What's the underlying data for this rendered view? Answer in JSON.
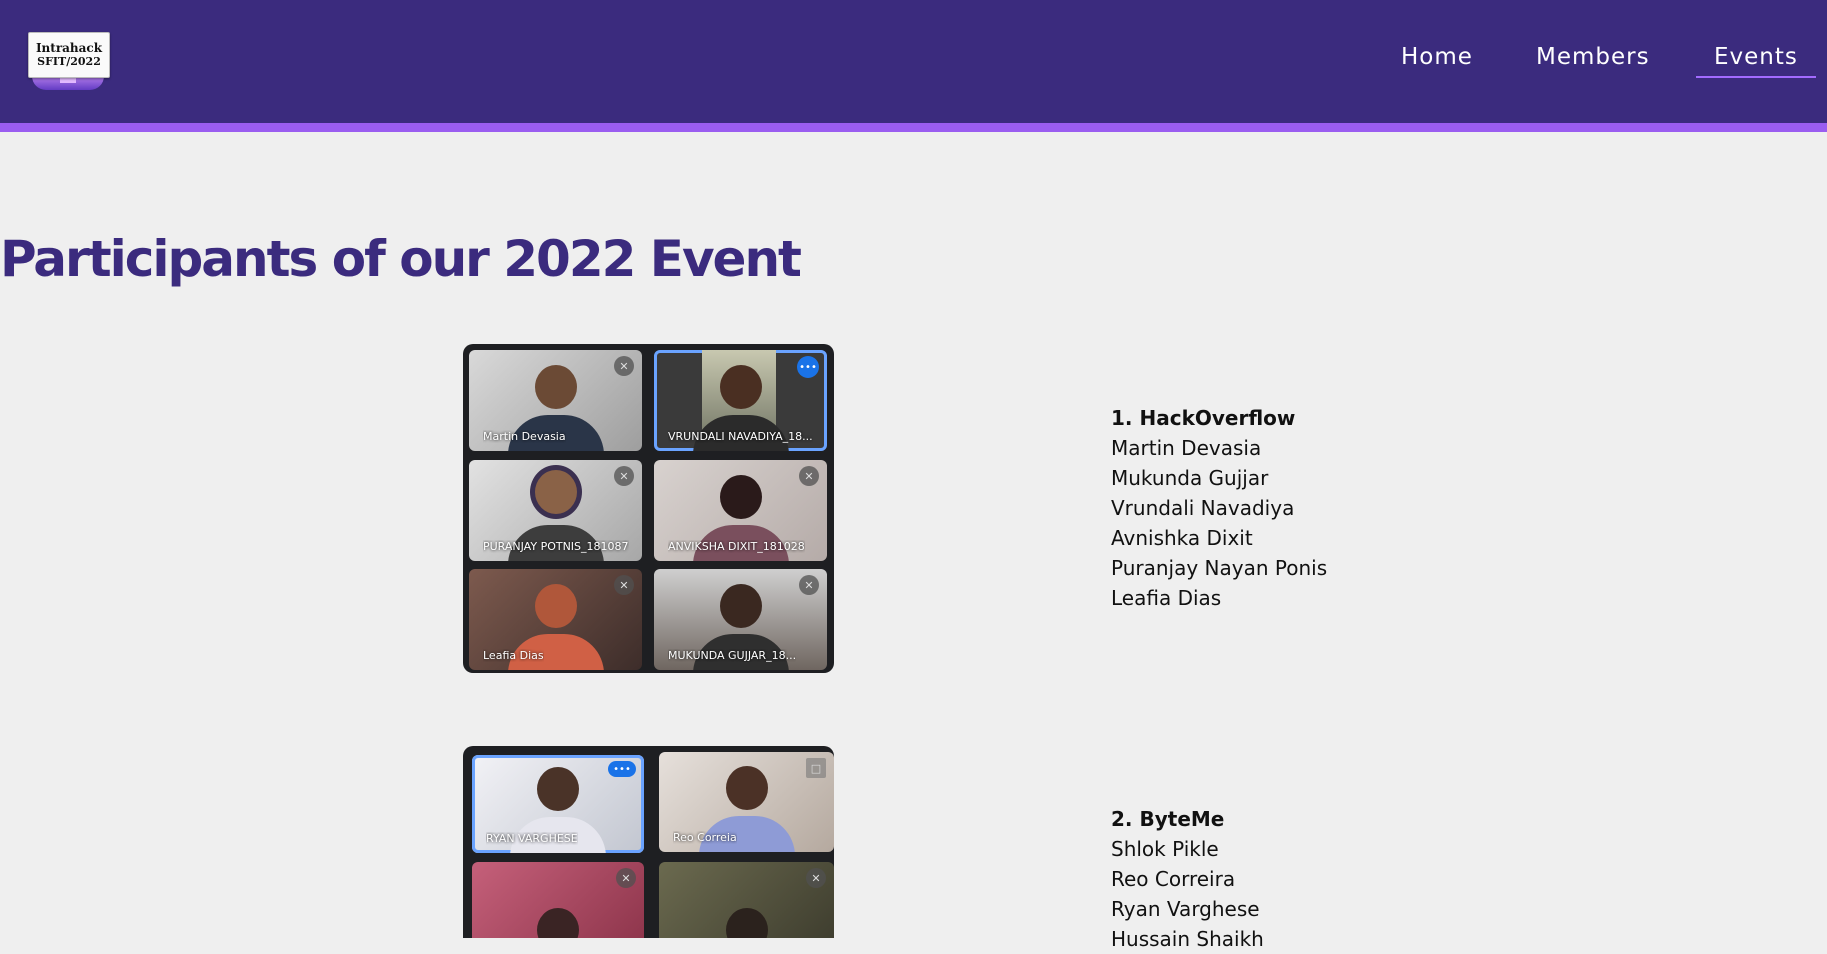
{
  "brand": {
    "logo_line1": "Intrahack",
    "logo_line2": "SFIT/2022"
  },
  "nav": {
    "home": "Home",
    "members": "Members",
    "events": "Events",
    "active": "Events"
  },
  "page": {
    "title": "Participants of our 2022 Event"
  },
  "colors": {
    "nav_bg": "#3b2b7e",
    "accent": "#9a5df0",
    "title": "#3b2b7e",
    "page_bg": "#efefef"
  },
  "teams": [
    {
      "name": "1. HackOverflow",
      "members": [
        "Martin Devasia",
        "Mukunda Gujjar",
        "Vrundali Navadiya",
        "Avnishka Dixit",
        "Puranjay Nayan Ponis",
        "Leafia Dias"
      ],
      "video_tiles": [
        {
          "label": "Martin Devasia",
          "icon": "mic-off-icon"
        },
        {
          "label": "VRUNDALI NAVADIYA_18...",
          "icon": "speaking-icon"
        },
        {
          "label": "PURANJAY POTNIS_181087",
          "icon": "mic-off-icon"
        },
        {
          "label": "ANVIKSHA DIXIT_181028",
          "icon": "mic-off-icon"
        },
        {
          "label": "Leafia Dias",
          "icon": "mic-off-icon"
        },
        {
          "label": "MUKUNDA GUJJAR_18...",
          "icon": "mic-off-icon"
        }
      ]
    },
    {
      "name": "2. ByteMe",
      "members": [
        "Shlok Pikle",
        "Reo Correira",
        "Ryan Varghese",
        "Hussain Shaikh"
      ],
      "video_tiles": [
        {
          "label": "RYAN VARGHESE",
          "icon": "more-options-icon"
        },
        {
          "label": "Reo Correia",
          "icon": "screen-icon"
        },
        {
          "label": "",
          "icon": "mic-off-icon"
        },
        {
          "label": "",
          "icon": "mic-off-icon"
        }
      ]
    }
  ]
}
